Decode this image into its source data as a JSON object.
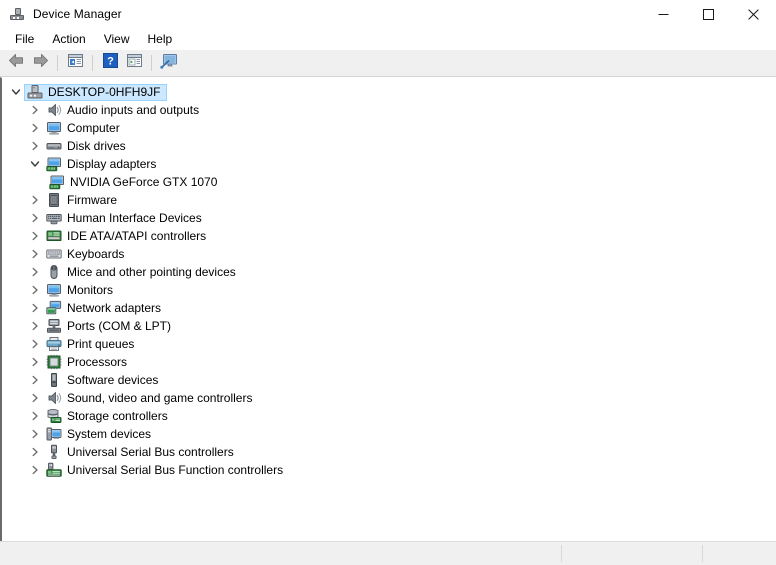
{
  "window": {
    "title": "Device Manager",
    "icon": "device-manager-icon",
    "controls": [
      {
        "name": "minimize-button",
        "glyph": "minimize"
      },
      {
        "name": "maximize-button",
        "glyph": "maximize"
      },
      {
        "name": "close-button",
        "glyph": "close"
      }
    ]
  },
  "menubar": {
    "items": [
      {
        "label": "File",
        "name": "menu-file"
      },
      {
        "label": "Action",
        "name": "menu-action"
      },
      {
        "label": "View",
        "name": "menu-view"
      },
      {
        "label": "Help",
        "name": "menu-help"
      }
    ]
  },
  "toolbar": {
    "buttons": [
      {
        "name": "back-button",
        "icon": "back-arrow-icon"
      },
      {
        "name": "forward-button",
        "icon": "forward-arrow-icon"
      },
      {
        "name": "show-hide-console-tree-button",
        "icon": "console-tree-icon"
      },
      {
        "name": "help-button",
        "icon": "help-question-icon"
      },
      {
        "name": "properties-button",
        "icon": "properties-icon"
      },
      {
        "name": "scan-for-hardware-changes-button",
        "icon": "scan-hardware-icon"
      }
    ]
  },
  "tree": {
    "nodes": [
      {
        "label": "DESKTOP-0HFH9JF",
        "level": 0,
        "state": "expanded",
        "selected": true,
        "icon": "computer-root-icon"
      },
      {
        "label": "Audio inputs and outputs",
        "level": 1,
        "state": "collapsed",
        "selected": false,
        "icon": "speaker-icon"
      },
      {
        "label": "Computer",
        "level": 1,
        "state": "collapsed",
        "selected": false,
        "icon": "monitor-icon"
      },
      {
        "label": "Disk drives",
        "level": 1,
        "state": "collapsed",
        "selected": false,
        "icon": "disk-drive-icon"
      },
      {
        "label": "Display adapters",
        "level": 1,
        "state": "expanded",
        "selected": false,
        "icon": "display-adapter-icon"
      },
      {
        "label": "NVIDIA GeForce GTX 1070",
        "level": 2,
        "state": "leaf",
        "selected": false,
        "icon": "display-adapter-icon"
      },
      {
        "label": "Firmware",
        "level": 1,
        "state": "collapsed",
        "selected": false,
        "icon": "firmware-icon"
      },
      {
        "label": "Human Interface Devices",
        "level": 1,
        "state": "collapsed",
        "selected": false,
        "icon": "hid-icon"
      },
      {
        "label": "IDE ATA/ATAPI controllers",
        "level": 1,
        "state": "collapsed",
        "selected": false,
        "icon": "ide-controller-icon"
      },
      {
        "label": "Keyboards",
        "level": 1,
        "state": "collapsed",
        "selected": false,
        "icon": "keyboard-icon"
      },
      {
        "label": "Mice and other pointing devices",
        "level": 1,
        "state": "collapsed",
        "selected": false,
        "icon": "mouse-icon"
      },
      {
        "label": "Monitors",
        "level": 1,
        "state": "collapsed",
        "selected": false,
        "icon": "monitor-icon"
      },
      {
        "label": "Network adapters",
        "level": 1,
        "state": "collapsed",
        "selected": false,
        "icon": "network-adapter-icon"
      },
      {
        "label": "Ports (COM & LPT)",
        "level": 1,
        "state": "collapsed",
        "selected": false,
        "icon": "port-icon"
      },
      {
        "label": "Print queues",
        "level": 1,
        "state": "collapsed",
        "selected": false,
        "icon": "printer-icon"
      },
      {
        "label": "Processors",
        "level": 1,
        "state": "collapsed",
        "selected": false,
        "icon": "processor-icon"
      },
      {
        "label": "Software devices",
        "level": 1,
        "state": "collapsed",
        "selected": false,
        "icon": "software-device-icon"
      },
      {
        "label": "Sound, video and game controllers",
        "level": 1,
        "state": "collapsed",
        "selected": false,
        "icon": "speaker-icon"
      },
      {
        "label": "Storage controllers",
        "level": 1,
        "state": "collapsed",
        "selected": false,
        "icon": "storage-controller-icon"
      },
      {
        "label": "System devices",
        "level": 1,
        "state": "collapsed",
        "selected": false,
        "icon": "system-device-icon"
      },
      {
        "label": "Universal Serial Bus controllers",
        "level": 1,
        "state": "collapsed",
        "selected": false,
        "icon": "usb-icon"
      },
      {
        "label": "Universal Serial Bus Function controllers",
        "level": 1,
        "state": "collapsed",
        "selected": false,
        "icon": "usb-function-icon"
      }
    ]
  },
  "statusbar": {
    "panes": [
      {
        "name": "status-pane-main",
        "text": ""
      },
      {
        "name": "status-pane-secondary",
        "text": ""
      },
      {
        "name": "status-pane-tertiary",
        "text": ""
      }
    ]
  },
  "colors": {
    "selection": "#cce8ff",
    "selection_border": "#99d1ff",
    "toolbar_bg": "#f0f0f0",
    "window_bg": "#ffffff",
    "status_bg": "#f0f0f0",
    "arrow_fill": "#8c8c8c",
    "help_blue": "#1f5fbf"
  }
}
